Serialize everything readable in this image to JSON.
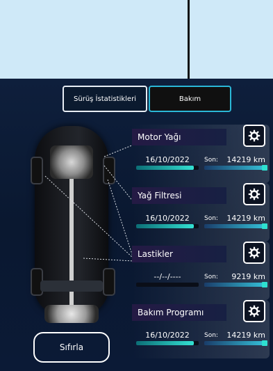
{
  "tabs": [
    {
      "label": "Sürüş İstatistikleri"
    },
    {
      "label": "Bakım"
    }
  ],
  "cards": [
    {
      "title": "Motor Yağı",
      "date": "16/10/2022",
      "son_label": "Son:",
      "km": "14219  km",
      "progress": 0.92,
      "km_progress": 1.0
    },
    {
      "title": "Yağ Filtresi",
      "date": "16/10/2022",
      "son_label": "Son:",
      "km": "14219  km",
      "progress": 0.92,
      "km_progress": 1.0
    },
    {
      "title": "Lastikler",
      "date": "--/--/----",
      "son_label": "Son:",
      "km": "9219  km",
      "progress": 0.0,
      "km_progress": 1.0
    },
    {
      "title": "Bakım Programı",
      "date": "16/10/2022",
      "son_label": "Son:",
      "km": "14219  km",
      "progress": 0.92,
      "km_progress": 1.0
    }
  ],
  "reset_label": "Sıfırla",
  "colors": {
    "accent": "#2bb8d8",
    "bar_fill": "#33e0d2",
    "panel": "#0e1f3c"
  }
}
